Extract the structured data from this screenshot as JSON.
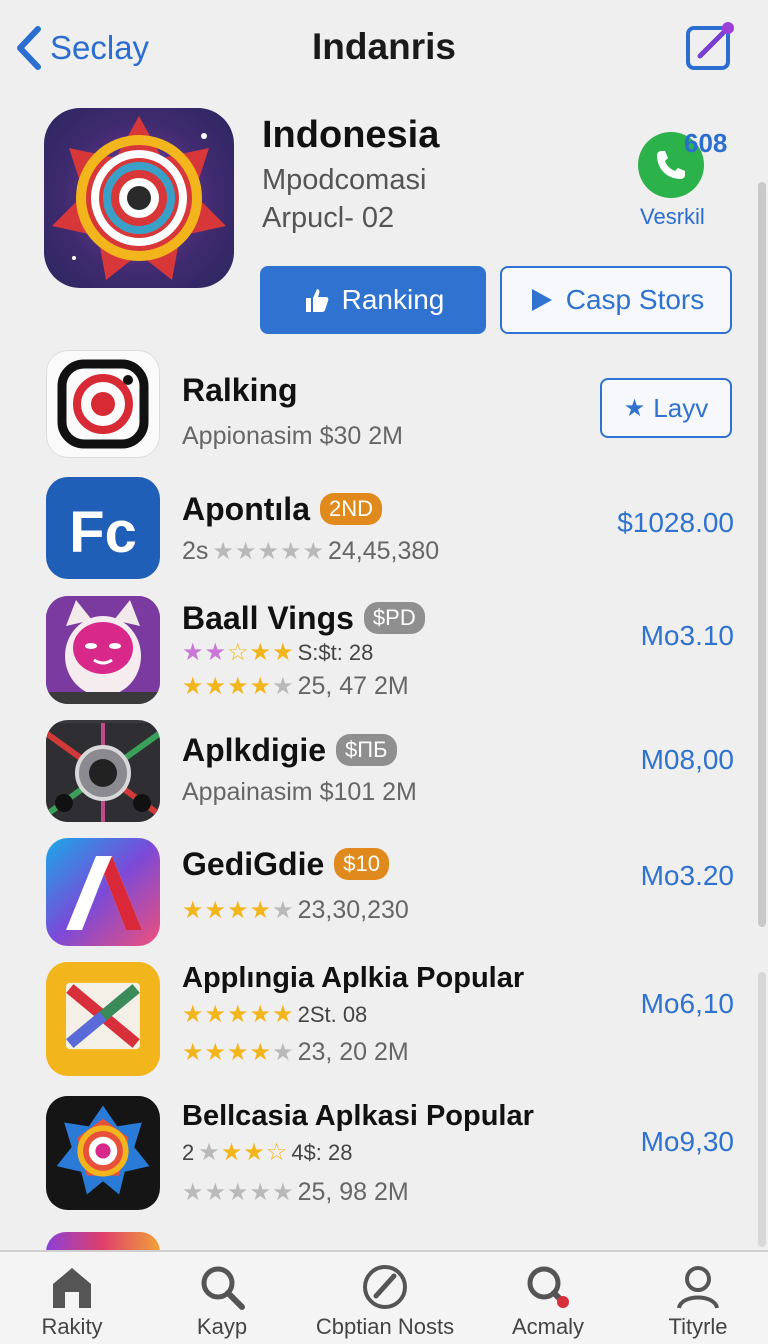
{
  "nav": {
    "back_label": "Seclay",
    "title": "Indanris"
  },
  "hero": {
    "title": "Indonesia",
    "subtitle1": "Mpodcomasi",
    "subtitle2": "Arpucl- 02",
    "badge_count": "608",
    "badge_label": "Vesrkil",
    "primary_button": "Ranking",
    "secondary_button": "Casp Stors"
  },
  "apps": [
    {
      "name": "Ralking",
      "meta": "Appionasim $30 2M",
      "action": "Layv"
    },
    {
      "name": "Apontıla",
      "badge": "2ND",
      "meta_prefix": "2s",
      "rating_text": "24,45,380",
      "price": "$1028.00"
    },
    {
      "name": "Baall Vings",
      "badge": "$PD",
      "meta1": "S:$t: 28",
      "meta2": "25, 47 2M",
      "price": "Mo3.10"
    },
    {
      "name": "Aplkdigie",
      "badge": "$ПБ",
      "meta": "Appainasim $101 2M",
      "price": "M08,00"
    },
    {
      "name": "GediGdie",
      "badge": "$10",
      "rating_text": "23,30,230",
      "price": "Mo3.20"
    },
    {
      "name": "Applıngia Aplkia Popular",
      "meta1": "2St. 08",
      "meta2": "23, 20 2M",
      "price": "Mo6,10"
    },
    {
      "name": "Bellcasia Aplkasi Popular",
      "meta_prefix": "2",
      "meta1": "4$: 28",
      "meta2": "25, 98 2M",
      "price": "Mo9,30"
    }
  ],
  "tabs": [
    {
      "label": "Rakity",
      "icon": "home-icon"
    },
    {
      "label": "Kayp",
      "icon": "search-icon"
    },
    {
      "label": "Cbptian Nosts",
      "icon": "compass-icon"
    },
    {
      "label": "Acmaly",
      "icon": "search-notification-icon"
    },
    {
      "label": "Tityrle",
      "icon": "person-icon"
    }
  ],
  "colors": {
    "accent": "#2f72cf",
    "star": "#f2b51c",
    "badge_orange": "#e08a1e",
    "badge_gray": "#8f8f8f",
    "phone_green": "#2bb24a"
  }
}
